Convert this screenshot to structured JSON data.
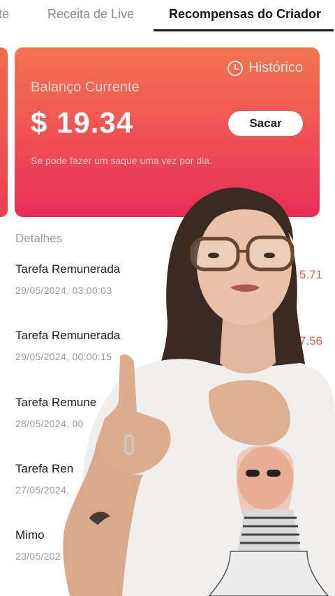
{
  "tabs": [
    {
      "label": "nte",
      "active": false
    },
    {
      "label": "Receita de Live",
      "active": false
    },
    {
      "label": "Recompensas do Criador",
      "active": true
    }
  ],
  "balance_card": {
    "history_label": "Histórico",
    "balance_label": "Balanço Currente",
    "amount": "$ 19.34",
    "withdraw_label": "Sacar",
    "note": "Se pode fazer um saque uma vez por dia."
  },
  "details": {
    "header": "Detalhes",
    "items": [
      {
        "title": "Tarefa Remunerada",
        "date": "29/05/2024, 03:00:03",
        "amount": "5.71"
      },
      {
        "title": "Tarefa Remunerada",
        "date": "29/05/2024, 00:00:15",
        "amount": "+$7.56"
      },
      {
        "title": "Tarefa Remune",
        "date": "28/05/2024, 00",
        "amount": ""
      },
      {
        "title": "Tarefa Ren",
        "date": "27/05/2024,",
        "amount": ""
      },
      {
        "title": "Mimo",
        "date": "23/05/202",
        "amount": ""
      }
    ]
  },
  "colors": {
    "card_top": "#f3744f",
    "card_bottom": "#ea2d57",
    "amount_positive": "#ef5a3f",
    "active_tab": "#16161a"
  },
  "icons": {
    "history": "clock-icon"
  }
}
